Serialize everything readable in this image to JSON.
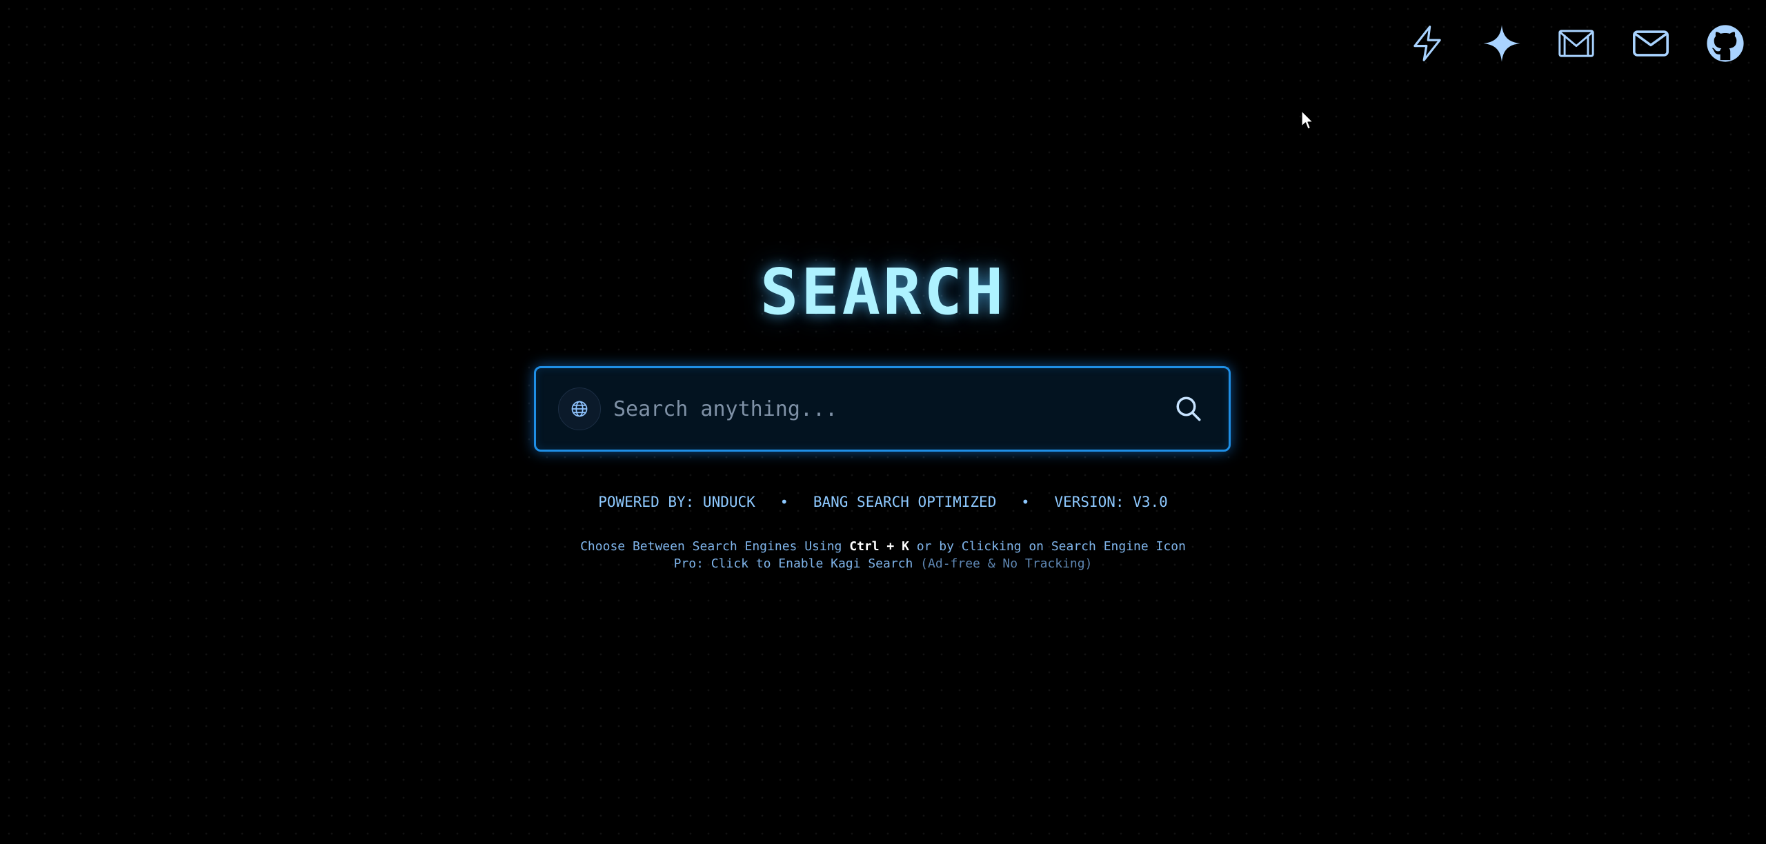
{
  "top_icons": [
    {
      "name": "lightning-icon"
    },
    {
      "name": "sparkle-icon"
    },
    {
      "name": "gmail-icon"
    },
    {
      "name": "mail-icon"
    },
    {
      "name": "github-icon"
    }
  ],
  "title": "SEARCH",
  "search": {
    "placeholder": "Search anything...",
    "engine_icon": "globe-icon",
    "submit_icon": "search-icon"
  },
  "info": {
    "powered_by": "POWERED BY: UNDUCK",
    "separator": "•",
    "bang": "BANG SEARCH OPTIMIZED",
    "version": "VERSION: V3.0"
  },
  "hints": {
    "line1_prefix": "Choose Between Search Engines Using ",
    "line1_shortcut": "Ctrl + K",
    "line1_suffix": " or by Clicking on Search Engine Icon",
    "line2_link": "Pro: Click to Enable Kagi Search",
    "line2_note": " (Ad-free & No Tracking)"
  },
  "colors": {
    "accent": "#1f8fe6",
    "title": "#aef2ff",
    "text": "#8ec9ff",
    "background": "#000000"
  }
}
